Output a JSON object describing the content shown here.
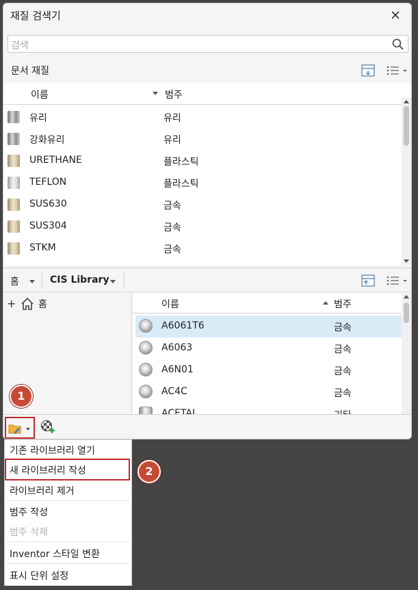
{
  "window": {
    "title": "재질 검색기",
    "close_icon": "close-icon"
  },
  "search": {
    "placeholder": "검색"
  },
  "document": {
    "label": "문서 재질",
    "columns": {
      "name": "이름",
      "category": "범주"
    },
    "rows": [
      {
        "name": "유리",
        "category": "유리",
        "swatch": "glass"
      },
      {
        "name": "강화유리",
        "category": "유리",
        "swatch": "glass"
      },
      {
        "name": "URETHANE",
        "category": "플라스틱",
        "swatch": "cream"
      },
      {
        "name": "TEFLON",
        "category": "플라스틱",
        "swatch": "white"
      },
      {
        "name": "SUS630",
        "category": "금속",
        "swatch": "cream"
      },
      {
        "name": "SUS304",
        "category": "금속",
        "swatch": "cream"
      },
      {
        "name": "STKM",
        "category": "금속",
        "swatch": "cream"
      }
    ]
  },
  "library": {
    "home_label": "홈",
    "selected_library": "CIS Library",
    "tree": {
      "home_label": "홈"
    },
    "columns": {
      "name": "이름",
      "category": "범주"
    },
    "rows": [
      {
        "name": "A6061T6",
        "category": "금속",
        "selected": true
      },
      {
        "name": "A6063",
        "category": "금속"
      },
      {
        "name": "A6N01",
        "category": "금속"
      },
      {
        "name": "AC4C",
        "category": "금속"
      },
      {
        "name": "ACETAL",
        "category": "기타"
      }
    ]
  },
  "menu": {
    "items": [
      {
        "label": "기존 라이브러리 열기"
      },
      {
        "label": "새 라이브러리 작성"
      },
      {
        "label": "라이브러리 제거"
      },
      {
        "label": "범주 작성"
      },
      {
        "label": "범주 삭제",
        "disabled": true
      },
      {
        "label": "Inventor 스타일 변환"
      },
      {
        "label": "표시 단위 설정"
      }
    ]
  },
  "callouts": {
    "step1": "1",
    "step2": "2"
  },
  "colors": {
    "highlight": "#c0272d",
    "badge": "#c64a34",
    "selection": "#d9ebf7",
    "backdrop": "#454444"
  }
}
